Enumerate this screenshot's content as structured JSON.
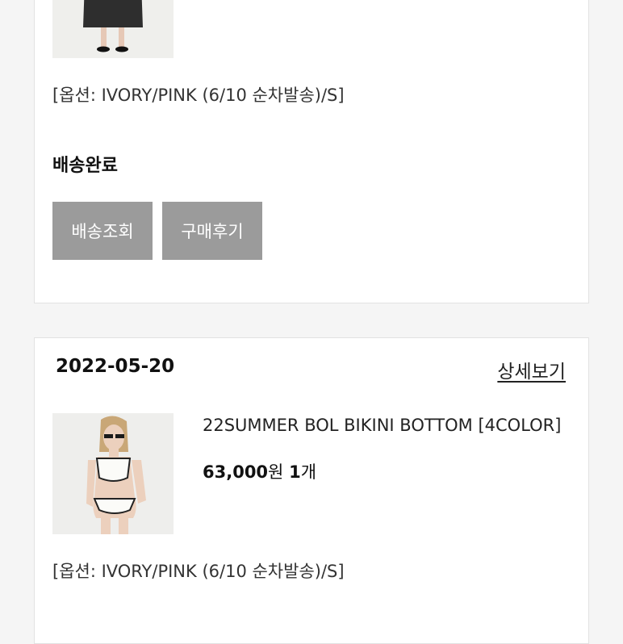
{
  "orders": [
    {
      "option": "[옵션: IVORY/PINK (6/10 순차발송)/S]",
      "status": "배송완료",
      "buttons": {
        "tracking": "배송조회",
        "review": "구매후기"
      }
    },
    {
      "date": "2022-05-20",
      "detail_link": "상세보기",
      "product_name": "22SUMMER BOL BIKINI BOTTOM [4COLOR]",
      "price": "63,000",
      "price_unit": "원",
      "quantity": "1",
      "quantity_unit": "개",
      "option": "[옵션: IVORY/PINK (6/10 순차발송)/S]"
    }
  ]
}
